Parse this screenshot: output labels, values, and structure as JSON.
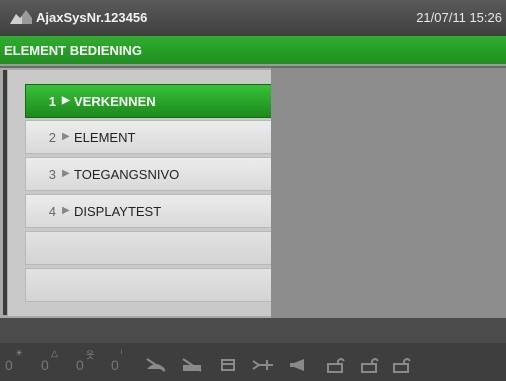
{
  "titlebar": {
    "system_name": "AjaxSysNr.123456",
    "datetime": "21/07/11 15:26"
  },
  "header": {
    "title": "ELEMENT BEDIENING"
  },
  "menu": {
    "items": [
      {
        "num": "1",
        "label": "VERKENNEN",
        "active": true
      },
      {
        "num": "2",
        "label": "ELEMENT",
        "active": false
      },
      {
        "num": "3",
        "label": "TOEGANGSNIVO",
        "active": false
      },
      {
        "num": "4",
        "label": "DISPLAYTEST",
        "active": false
      }
    ],
    "arrow_glyph": "▶"
  },
  "status_counters": [
    {
      "value": "0",
      "icon": "sun-icon"
    },
    {
      "value": "0",
      "icon": "triangle-icon"
    },
    {
      "value": "0",
      "icon": "person-icon"
    },
    {
      "value": "0",
      "icon": "tick-icon"
    }
  ],
  "status_icons": [
    "no-detection-icon",
    "no-signal-icon",
    "filter-icon",
    "network-icon",
    "speaker-icon",
    "lock-open-icon-1",
    "lock-open-icon-2",
    "lock-open-icon-3"
  ],
  "colors": {
    "accent_green": "#22a022",
    "titlebar": "#444444",
    "panel": "#8c8c8c"
  }
}
